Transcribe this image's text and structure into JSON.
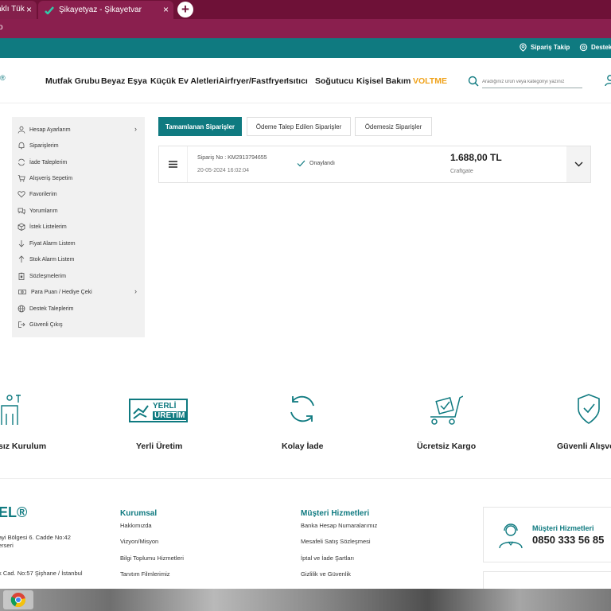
{
  "browser": {
    "tabs": [
      {
        "label": "aklı Tük",
        "close": "×"
      },
      {
        "label": "Şikayetyaz - Şikayetvar",
        "close": "×"
      }
    ],
    "new_tab": "+",
    "address_fragment": "o"
  },
  "topbar": {
    "order_tracking": "Sipariş Takip",
    "support": "Destek"
  },
  "header": {
    "logo_fragment": "®",
    "nav": [
      "Mutfak Grubu",
      "Beyaz Eşya",
      "Küçük Ev Aletleri",
      "Airfryer/Fastfryer",
      "Isıtıcı",
      "Soğutucu",
      "Kişisel Bakım",
      "VOLTME"
    ],
    "search_placeholder": "Aradığınız ürün veya kategoriyi yazınız"
  },
  "sidebar": {
    "items": [
      {
        "label": "Hesap Ayarlarım",
        "icon": "user-icon",
        "has_chevron": true
      },
      {
        "label": "Siparişlerim",
        "icon": "bell-icon"
      },
      {
        "label": "İade Taleplerim",
        "icon": "refresh-icon"
      },
      {
        "label": "Alışveriş Sepetim",
        "icon": "cart-icon"
      },
      {
        "label": "Favorilerim",
        "icon": "heart-icon"
      },
      {
        "label": "Yorumlarım",
        "icon": "comments-icon"
      },
      {
        "label": "İstek Listelerim",
        "icon": "box-icon"
      },
      {
        "label": "Fiyat Alarm Listem",
        "icon": "arrow-down-icon"
      },
      {
        "label": "Stok Alarm Listem",
        "icon": "arrow-up-icon"
      },
      {
        "label": "Sözleşmelerim",
        "icon": "clipboard-icon"
      },
      {
        "label": "Para Puan / Hediye Çeki",
        "icon": "money-icon",
        "has_chevron": true
      },
      {
        "label": "Destek Taleplerim",
        "icon": "globe-icon"
      },
      {
        "label": "Güvenli Çıkış",
        "icon": "logout-icon"
      }
    ],
    "chevron": "›"
  },
  "orders": {
    "tabs": [
      "Tamamlanan Siparişler",
      "Ödeme Talep Edilen Siparişler",
      "Ödemesiz Siparişler"
    ],
    "active_tab": 0,
    "card": {
      "order_no": "Sipariş No : KM2913794655",
      "date": "20-05-2024 16:02:04",
      "status": "Onaylandı",
      "price": "1.688,00 TL",
      "brand": "Craftgate"
    }
  },
  "features": [
    {
      "label": "sız Kurulum",
      "icon": "tools-person-icon"
    },
    {
      "label": "Yerli Üretim",
      "icon": "yerli-uretim-badge-icon",
      "badge_lines": [
        "YERLİ",
        "ÜRETİM"
      ]
    },
    {
      "label": "Kolay İade",
      "icon": "return-cycle-icon"
    },
    {
      "label": "Ücretsiz Kargo",
      "icon": "delivery-cart-icon"
    },
    {
      "label": "Güvenli Alışve",
      "icon": "shield-check-icon"
    }
  ],
  "footer": {
    "logo": "EL®",
    "address_lines": [
      "ayi Bölgesi 6. Cadde No:42",
      "erseri",
      "k Cad. No:57 Şişhane / İstanbul"
    ],
    "corporate": {
      "title": "Kurumsal",
      "links": [
        "Hakkımızda",
        "Vizyon/Misyon",
        "Bilgi Toplumu Hizmetleri",
        "Tanıtım Filmlerimiz"
      ]
    },
    "customer_services": {
      "title": "Müşteri Hizmetleri",
      "links": [
        "Banka Hesap Numaralarımız",
        "Mesafeli Satış Sözleşmesi",
        "İptal ve İade Şartları",
        "Gizlilik ve Güvenlik"
      ]
    },
    "support_card": {
      "title": "Müşteri Hizmetleri",
      "phone": "0850 333 56 85"
    }
  },
  "colors": {
    "brand_teal": "#0f7a80",
    "chrome_maroon": "#6e1137",
    "voltme_orange": "#f0a21a"
  }
}
